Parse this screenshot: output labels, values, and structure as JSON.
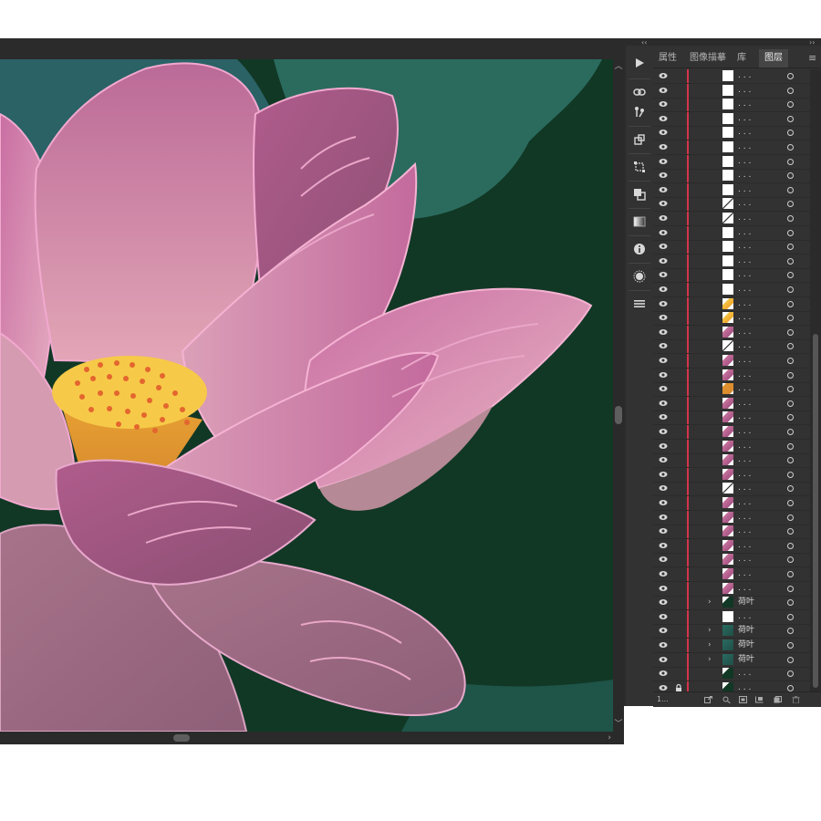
{
  "panel": {
    "tabs": [
      {
        "label": "属性"
      },
      {
        "label": "图像描摹"
      },
      {
        "label": "库"
      },
      {
        "label": "图层",
        "active": true
      }
    ],
    "layers": [
      {
        "name": ". . .",
        "thumb": "white",
        "expandable": false,
        "locked": false
      },
      {
        "name": ". . .",
        "thumb": "white",
        "expandable": false,
        "locked": false
      },
      {
        "name": ". . .",
        "thumb": "white",
        "expandable": false,
        "locked": false
      },
      {
        "name": ". . .",
        "thumb": "white",
        "expandable": false,
        "locked": false
      },
      {
        "name": ". . .",
        "thumb": "white",
        "expandable": false,
        "locked": false
      },
      {
        "name": ". . .",
        "thumb": "white",
        "expandable": false,
        "locked": false
      },
      {
        "name": ". . .",
        "thumb": "white",
        "expandable": false,
        "locked": false
      },
      {
        "name": ". . .",
        "thumb": "white",
        "expandable": false,
        "locked": false
      },
      {
        "name": ". . .",
        "thumb": "white",
        "expandable": false,
        "locked": false
      },
      {
        "name": ". . .",
        "thumb": "line",
        "expandable": false,
        "locked": false
      },
      {
        "name": ". . .",
        "thumb": "line",
        "expandable": false,
        "locked": false
      },
      {
        "name": ". . .",
        "thumb": "white",
        "expandable": false,
        "locked": false
      },
      {
        "name": ". . .",
        "thumb": "white",
        "expandable": false,
        "locked": false
      },
      {
        "name": ". . .",
        "thumb": "white",
        "expandable": false,
        "locked": false
      },
      {
        "name": ". . .",
        "thumb": "white",
        "expandable": false,
        "locked": false
      },
      {
        "name": ". . .",
        "thumb": "white",
        "expandable": false,
        "locked": false
      },
      {
        "name": ". . .",
        "thumb": "yellow",
        "expandable": false,
        "locked": false
      },
      {
        "name": ". . .",
        "thumb": "yellow",
        "expandable": false,
        "locked": false
      },
      {
        "name": ". . .",
        "thumb": "pink",
        "expandable": false,
        "locked": false
      },
      {
        "name": ". . .",
        "thumb": "line",
        "expandable": false,
        "locked": false
      },
      {
        "name": ". . .",
        "thumb": "pink",
        "expandable": false,
        "locked": false
      },
      {
        "name": ". . .",
        "thumb": "pink",
        "expandable": false,
        "locked": false
      },
      {
        "name": ". . .",
        "thumb": "orange",
        "expandable": false,
        "locked": false
      },
      {
        "name": ". . .",
        "thumb": "pink",
        "expandable": false,
        "locked": false
      },
      {
        "name": ". . .",
        "thumb": "pink",
        "expandable": false,
        "locked": false
      },
      {
        "name": ". . .",
        "thumb": "pink",
        "expandable": false,
        "locked": false
      },
      {
        "name": ". . .",
        "thumb": "pink",
        "expandable": false,
        "locked": false
      },
      {
        "name": ". . .",
        "thumb": "pink",
        "expandable": false,
        "locked": false
      },
      {
        "name": ". . .",
        "thumb": "pink",
        "expandable": false,
        "locked": false
      },
      {
        "name": ". . .",
        "thumb": "line",
        "expandable": false,
        "locked": false
      },
      {
        "name": ". . .",
        "thumb": "pink",
        "expandable": false,
        "locked": false
      },
      {
        "name": ". . .",
        "thumb": "pink",
        "expandable": false,
        "locked": false
      },
      {
        "name": ". . .",
        "thumb": "pink",
        "expandable": false,
        "locked": false
      },
      {
        "name": ". . .",
        "thumb": "pink",
        "expandable": false,
        "locked": false
      },
      {
        "name": ". . .",
        "thumb": "pink",
        "expandable": false,
        "locked": false
      },
      {
        "name": ". . .",
        "thumb": "pink",
        "expandable": false,
        "locked": false
      },
      {
        "name": ". . .",
        "thumb": "pink",
        "expandable": false,
        "locked": false
      },
      {
        "name": "荷叶",
        "thumb": "dark",
        "expandable": true,
        "locked": false
      },
      {
        "name": ". . .",
        "thumb": "white",
        "expandable": false,
        "locked": false
      },
      {
        "name": "荷叶",
        "thumb": "teal",
        "expandable": true,
        "locked": false
      },
      {
        "name": "荷叶",
        "thumb": "teal",
        "expandable": true,
        "locked": false
      },
      {
        "name": "荷叶",
        "thumb": "teal",
        "expandable": true,
        "locked": false
      },
      {
        "name": ". . .",
        "thumb": "dark",
        "expandable": false,
        "locked": false
      },
      {
        "name": ". . .",
        "thumb": "dark",
        "expandable": false,
        "locked": true
      }
    ],
    "footer": {
      "count_label": "1..."
    }
  },
  "colors": {
    "app_bg": "#2b2b2b",
    "panel_bg": "#323232",
    "canvas_bg": "#113825",
    "layer_color_bar": "#d5344a",
    "petal_pink": "#c46a9a",
    "seedpod_yellow": "#f7c948",
    "leaf_teal": "#2a6b62"
  },
  "icons": {
    "tools": [
      "play-icon",
      "link-icon",
      "puppet-warp-icon",
      "artboard-icon",
      "transform-icon",
      "pathfinder-icon",
      "gradient-icon",
      "info-icon",
      "appearance-icon",
      "menu-icon"
    ]
  }
}
